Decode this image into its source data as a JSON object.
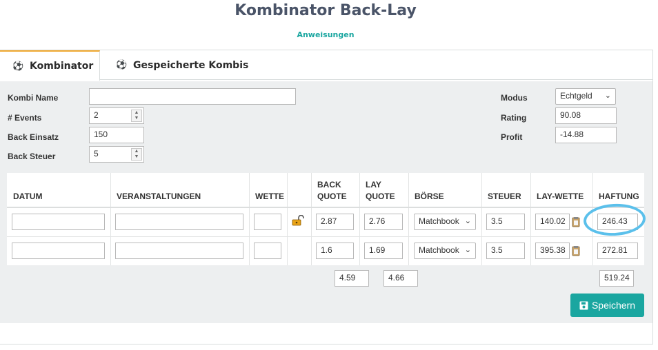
{
  "title": "Kombinator Back-Lay",
  "instructions_link": "Anweisungen",
  "tabs": [
    {
      "label": "Kombinator",
      "icon": "dribbble-icon"
    },
    {
      "label": "Gespeicherte Kombis",
      "icon": "dribbble-icon"
    }
  ],
  "form": {
    "kombi_name_label": "Kombi Name",
    "kombi_name_value": "",
    "events_label": "# Events",
    "events_value": "2",
    "back_einsatz_label": "Back Einsatz",
    "back_einsatz_value": "150",
    "back_steuer_label": "Back Steuer",
    "back_steuer_value": "5",
    "modus_label": "Modus",
    "modus_value": "Echtgeld",
    "rating_label": "Rating",
    "rating_value": "90.08",
    "profit_label": "Profit",
    "profit_value": "-14.88"
  },
  "table": {
    "headers": {
      "datum": "DATUM",
      "veranstaltungen": "VERANSTALTUNGEN",
      "wette": "WETTE",
      "back_quote_1": "BACK",
      "back_quote_2": "QUOTE",
      "lay_quote_1": "LAY",
      "lay_quote_2": "QUOTE",
      "boerse": "BÖRSE",
      "steuer": "STEUER",
      "lay_wette": "LAY-WETTE",
      "haftung": "HAFTUNG"
    },
    "rows": [
      {
        "datum": "",
        "veranstaltung": "",
        "wette": "",
        "back_quote": "2.87",
        "lay_quote": "2.76",
        "boerse": "Matchbook",
        "steuer": "3.5",
        "lay_wette": "140.02",
        "haftung": "246.43"
      },
      {
        "datum": "",
        "veranstaltung": "",
        "wette": "",
        "back_quote": "1.6",
        "lay_quote": "1.69",
        "boerse": "Matchbook",
        "steuer": "3.5",
        "lay_wette": "395.38",
        "haftung": "272.81"
      }
    ],
    "totals": {
      "back_quote": "4.59",
      "lay_quote": "4.66",
      "haftung": "519.24"
    }
  },
  "save_label": "Speichern",
  "colors": {
    "accent": "#1aa6a0",
    "tab_active": "#f0a830",
    "annotation": "#5bc0eb"
  }
}
